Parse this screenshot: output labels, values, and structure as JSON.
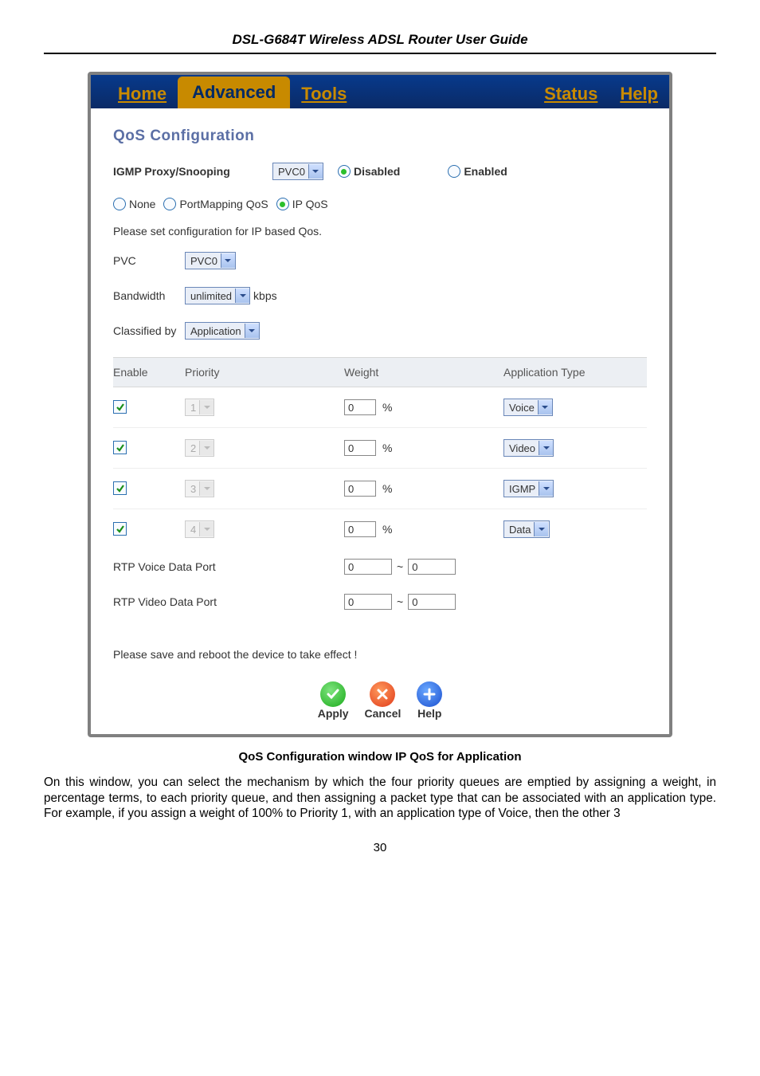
{
  "doc": {
    "header": "DSL-G684T Wireless ADSL Router User Guide",
    "caption": "QoS Configuration window IP QoS for Application",
    "body_text": "On this window, you can select the mechanism by which the four priority queues are emptied by assigning a weight, in percentage terms, to each priority queue, and then assigning a packet type that can be associated with an application type. For example, if you assign a weight of 100% to Priority 1, with an application type of Voice, then the other 3",
    "page_number": "30"
  },
  "tabs": {
    "home": "Home",
    "advanced": "Advanced",
    "tools": "Tools",
    "status": "Status",
    "help": "Help",
    "active": "advanced"
  },
  "qos": {
    "title": "QoS Configuration",
    "igmp_label": "IGMP Proxy/Snooping",
    "igmp_pvc": "PVC0",
    "disabled_label": "Disabled",
    "enabled_label": "Enabled",
    "igmp_state": "disabled",
    "mode_none": "None",
    "mode_portmapping": "PortMapping QoS",
    "mode_ipqos": "IP QoS",
    "mode_selected": "ipqos",
    "instruction": "Please set configuration for IP based Qos.",
    "pvc_label": "PVC",
    "pvc_value": "PVC0",
    "bandwidth_label": "Bandwidth",
    "bandwidth_value": "unlimited",
    "bandwidth_unit": "kbps",
    "classified_label": "Classified by",
    "classified_value": "Application",
    "headers": {
      "enable": "Enable",
      "priority": "Priority",
      "weight": "Weight",
      "apptype": "Application Type"
    },
    "rows": [
      {
        "enabled": true,
        "priority": "1",
        "priority_disabled": true,
        "weight": "0",
        "apptype": "Voice",
        "apptype_disabled": false
      },
      {
        "enabled": true,
        "priority": "2",
        "priority_disabled": true,
        "weight": "0",
        "apptype": "Video",
        "apptype_disabled": false
      },
      {
        "enabled": true,
        "priority": "3",
        "priority_disabled": true,
        "weight": "0",
        "apptype": "IGMP",
        "apptype_disabled": false
      },
      {
        "enabled": true,
        "priority": "4",
        "priority_disabled": true,
        "weight": "0",
        "apptype": "Data",
        "apptype_disabled": false
      }
    ],
    "weight_unit": "%",
    "rtp_voice_label": "RTP Voice Data Port",
    "rtp_voice_from": "0",
    "rtp_voice_to": "0",
    "rtp_video_label": "RTP Video Data Port",
    "rtp_video_from": "0",
    "rtp_video_to": "0",
    "range_sep": "~",
    "save_notice": "Please save and reboot the device to take effect !",
    "buttons": {
      "apply": "Apply",
      "cancel": "Cancel",
      "help": "Help"
    }
  }
}
